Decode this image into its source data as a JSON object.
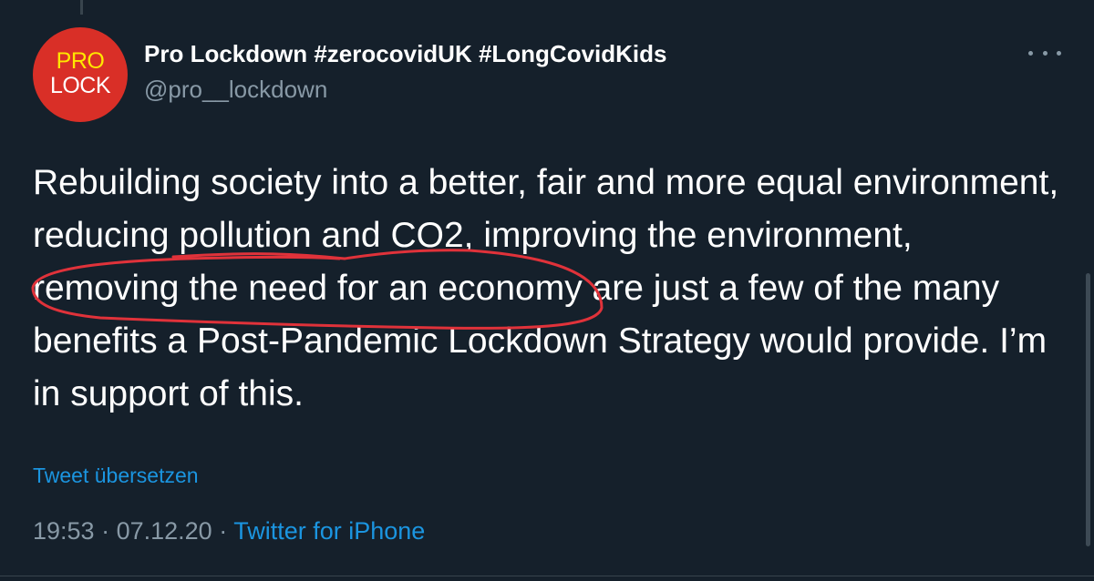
{
  "author": {
    "avatar_word_top": "PRO",
    "avatar_word_bottom": "LOCK",
    "display_name": "Pro Lockdown #zerocovidUK #LongCovidKids",
    "handle": "@pro__lockdown"
  },
  "tweet": {
    "lines": [
      "Rebuilding society into a better, fair and more equal environment,",
      "reducing pollution and CO2, improving the environment,",
      "removing the need for an economy are just a few of the many",
      "benefits a Post-Pandemic Lockdown Strategy would provide. I’m",
      "in support of this."
    ],
    "translate_link": "Tweet übersetzen",
    "time": "19:53",
    "separator": " · ",
    "date": "07.12.20",
    "source": "Twitter for iPhone"
  },
  "icons": {
    "more": "more-options-icon"
  },
  "colors": {
    "background": "#15202b",
    "avatar": "#d92f27",
    "avatar_accent": "#ffe600",
    "link": "#1b95e0",
    "secondary_text": "#8899a6",
    "annotation": "#e0323a"
  }
}
